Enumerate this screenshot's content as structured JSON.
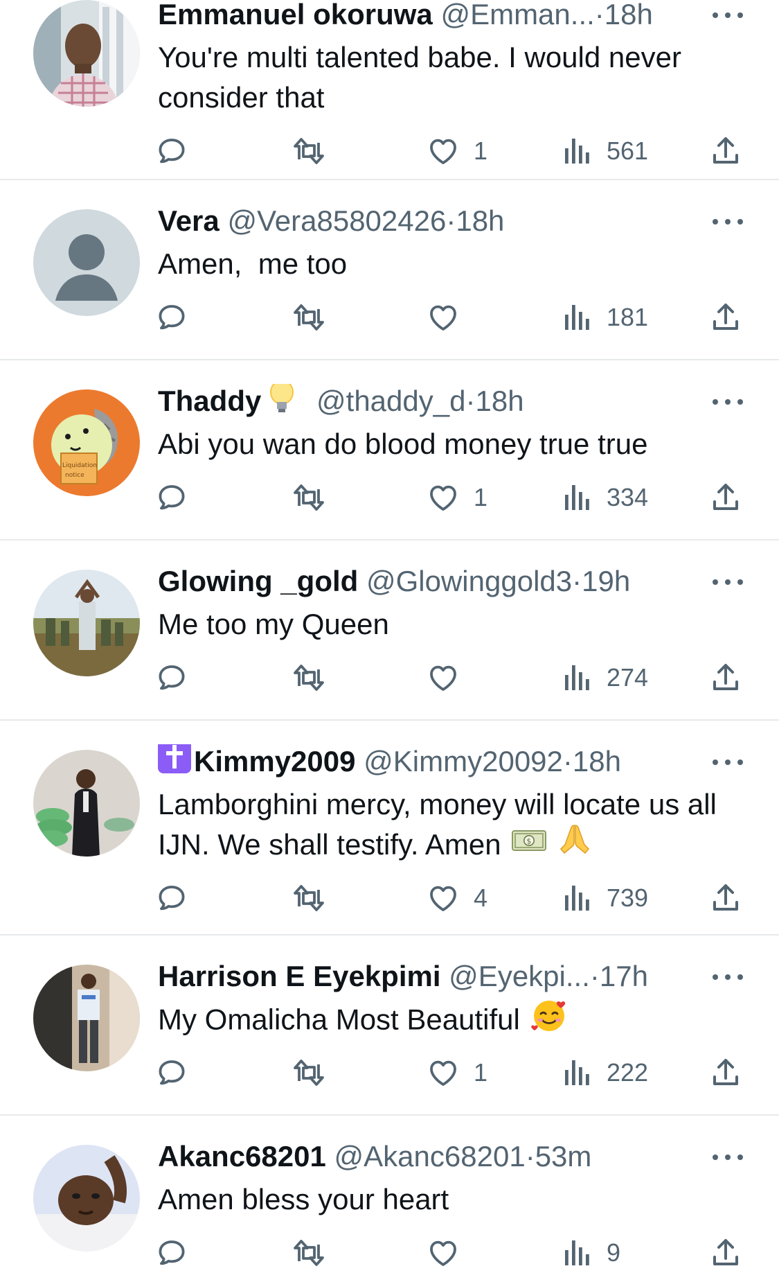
{
  "tweets": [
    {
      "name": "Emmanuel okoruwa",
      "handle": "@Emman...",
      "sep": "·",
      "time": "18h",
      "text": "You're multi talented babe. I would never consider that",
      "likes": "1",
      "views": "561",
      "avatar": "man-in-checked-shirt-photo"
    },
    {
      "name": "Vera",
      "handle": "@Vera85802426",
      "sep": "·",
      "time": "18h",
      "text": "Amen,  me too",
      "likes": "",
      "views": "181",
      "avatar": "default-person-placeholder"
    },
    {
      "name": "Thaddy",
      "name_emoji": "lightbulb-emoji",
      "handle": "@thaddy_d",
      "sep": "·",
      "time": "18h",
      "text": "Abi you wan do blood money true true",
      "likes": "1",
      "views": "334",
      "avatar": "cartoon-dinosaur-liquidation-notice",
      "avatar_text_1": "Liquidation",
      "avatar_text_2": "notice"
    },
    {
      "name": "Glowing _gold",
      "handle": "@Glowinggold3",
      "sep": "·",
      "time": "19h",
      "text": "Me too my Queen",
      "likes": "",
      "views": "274",
      "avatar": "camp-group-photo"
    },
    {
      "name": "Kimmy2009",
      "name_prefix_emoji": "latin-cross-emoji",
      "handle": "@Kimmy20092",
      "sep": "·",
      "time": "18h",
      "text": "Lamborghini mercy, money will locate us all IJN. We shall testify. Amen",
      "text_emojis": [
        "dollar-banknote-emoji",
        "folded-hands-emoji"
      ],
      "likes": "4",
      "views": "739",
      "avatar": "man-in-suit-photo"
    },
    {
      "name": "Harrison E Eyekpimi",
      "handle": "@Eyekpi...",
      "sep": "·",
      "time": "17h",
      "text": "My Omalicha Most Beautiful",
      "text_emojis": [
        "smiling-face-with-hearts-emoji"
      ],
      "likes": "1",
      "views": "222",
      "avatar": "man-standing-photo"
    },
    {
      "name": "Akanc68201",
      "handle": "@Akanc68201",
      "sep": "·",
      "time": "53m",
      "text": "Amen bless your heart",
      "likes": "",
      "views": "9",
      "avatar": "man-selfie-photo"
    }
  ],
  "colors": {
    "text": "#0f1419",
    "secondary": "#536471",
    "divider": "#e7e9eb",
    "cross_badge": "#8b5cf6"
  },
  "icons": {
    "reply": "reply-bubble-icon",
    "retweet": "retweet-icon",
    "like": "heart-icon",
    "views": "views-bars-icon",
    "share": "share-upload-icon",
    "more": "more-dots-icon"
  }
}
